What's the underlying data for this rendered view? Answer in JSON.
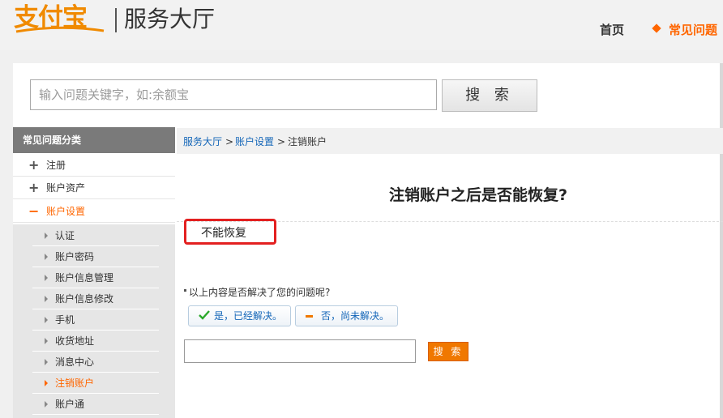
{
  "header": {
    "logo_text": "支付宝",
    "title": "服务大厅",
    "nav": {
      "home": "首页",
      "faq": "常见问题"
    }
  },
  "search": {
    "placeholder": "输入问题关键字，如:余额宝",
    "button": "搜 索"
  },
  "sidebar": {
    "heading": "常见问题分类",
    "categories": [
      {
        "sign": "+",
        "label": "注册"
      },
      {
        "sign": "+",
        "label": "账户资产"
      },
      {
        "sign": "−",
        "label": "账户设置"
      }
    ],
    "subitems": [
      "认证",
      "账户密码",
      "账户信息管理",
      "账户信息修改",
      "手机",
      "收货地址",
      "消息中心",
      "注销账户",
      "账户通"
    ]
  },
  "breadcrumb": {
    "items": [
      "服务大厅",
      "账户设置",
      "注销账户"
    ],
    "separator": ">"
  },
  "article": {
    "title": "注销账户之后是否能恢复?",
    "answer": "不能恢复"
  },
  "feedback": {
    "question": "以上内容是否解决了您的问题呢?",
    "yes": "是，已经解决。",
    "no": "否，尚未解决。",
    "submit": "搜 索"
  },
  "colors": {
    "accent": "#ff6600",
    "link": "#1466b8",
    "highlight_border": "#e32020"
  }
}
